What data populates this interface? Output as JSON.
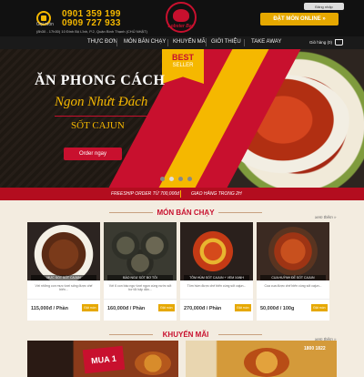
{
  "header": {
    "phone1": "0901 359 199",
    "phone_label": "Gọi món",
    "phone2": "0909 727 933",
    "hours": "(8h30 - 17h30) 10 Đinh Bộ Lĩnh, P.2, Quận Bình Thạnh (CHỦ NHẬT)",
    "logo_text": "Lobster Bay",
    "login_label": "Đăng nhập",
    "order_online_label": "ĐẶT MÓN ONLINE »"
  },
  "nav": {
    "items": [
      "THỰC ĐƠN",
      "MÓN BÁN CHẠY",
      "KHUYẾN MÃI",
      "GIỚI THIỆU",
      "TAKE AWAY"
    ],
    "cart_label": "Giỏ hàng (0)"
  },
  "hero": {
    "badge_line1": "BEST",
    "badge_line2": "SELLER",
    "title1": "ĂN PHONG CÁCH",
    "title2": "Ngon Nhứt Đách",
    "subtitle": "SỐT CAJUN",
    "cta_label": "Order ngay"
  },
  "promo_bar": {
    "left": "FREESHIP ORDER TỪ 700,000đ",
    "right": "GIAO HÀNG TRONG 2H"
  },
  "best_sellers": {
    "title": "MÓN BÁN CHẠY",
    "see_more": "xem thêm »",
    "cards": [
      {
        "name": "MỰC SỐT SỐT CAJUN",
        "desc": "Với những con mực tươi sống được chế biến...",
        "price": "115,000đ / Phần",
        "button": "Đặt món"
      },
      {
        "name": "BÀO NGƯ SỐT BƠ TỎI",
        "desc": "Với 6 con bào ngư tươi ngon cùng nước sốt bơ tỏi hấp dẫn...",
        "price": "160,000đ / Phần",
        "button": "Đặt món"
      },
      {
        "name": "TÔM HÙM SỐT CAJUN + VEM XANH",
        "desc": "Tôm hùm được chế biến cùng sốt cajun...",
        "price": "270,000đ / Phần",
        "button": "Đặt món"
      },
      {
        "name": "CUA HUỲNH ĐẾ SỐT CAJUN",
        "desc": "Cua cua được chế biến cùng sốt cajun...",
        "price": "50,000đ / 100g",
        "button": "Đặt món"
      }
    ]
  },
  "promotions": {
    "title": "KHUYẾN MÃI",
    "see_more": "xem thêm »",
    "left_banner": "MUA 1",
    "right_banner_phone": "1800 1822"
  },
  "colors": {
    "brand_red": "#c8102e",
    "accent_gold": "#f5b800",
    "dark": "#111111"
  }
}
